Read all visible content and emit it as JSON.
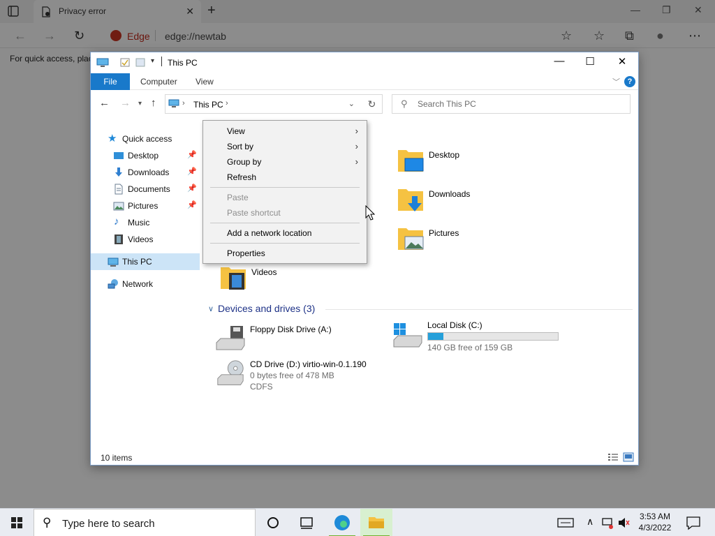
{
  "browser": {
    "tab_title": "Privacy error",
    "tab_close": "✕",
    "new_tab": "+",
    "brand": "Edge",
    "url": "edge://newtab",
    "quick_access_text": "For quick access, plac",
    "minimize": "—",
    "restore": "❐",
    "close": "✕"
  },
  "explorer": {
    "title": "This PC",
    "ribbon": {
      "file": "File",
      "computer": "Computer",
      "view": "View",
      "help": "?"
    },
    "address": {
      "crumb": "This PC",
      "separator": "›"
    },
    "search": {
      "placeholder": "Search This PC"
    },
    "nav": {
      "quick_access": "Quick access",
      "items": [
        {
          "label": "Desktop",
          "pinned": true
        },
        {
          "label": "Downloads",
          "pinned": true
        },
        {
          "label": "Documents",
          "pinned": true
        },
        {
          "label": "Pictures",
          "pinned": true
        },
        {
          "label": "Music",
          "pinned": false
        },
        {
          "label": "Videos",
          "pinned": false
        }
      ],
      "this_pc": "This PC",
      "network": "Network"
    },
    "folders": [
      {
        "label": "Desktop"
      },
      {
        "label": "Downloads"
      },
      {
        "label": "Pictures"
      },
      {
        "label": "Videos"
      }
    ],
    "devices_header": "Devices and drives (3)",
    "drives": {
      "floppy": {
        "name": "Floppy Disk Drive (A:)"
      },
      "local": {
        "name": "Local Disk (C:)",
        "free": "140 GB free of 159 GB",
        "used_fraction": 0.12
      },
      "cd": {
        "name": "CD Drive (D:) virtio-win-0.1.190",
        "free": "0 bytes free of 478 MB",
        "fs": "CDFS"
      }
    },
    "status": {
      "count": "10 items"
    }
  },
  "context_menu": {
    "items": [
      {
        "label": "View",
        "has_submenu": true,
        "disabled": false
      },
      {
        "label": "Sort by",
        "has_submenu": true,
        "disabled": false
      },
      {
        "label": "Group by",
        "has_submenu": true,
        "disabled": false
      },
      {
        "label": "Refresh",
        "has_submenu": false,
        "disabled": false
      },
      {
        "label": "Paste",
        "has_submenu": false,
        "disabled": true
      },
      {
        "label": "Paste shortcut",
        "has_submenu": false,
        "disabled": true
      },
      {
        "label": "Add a network location",
        "has_submenu": false,
        "disabled": false
      },
      {
        "label": "Properties",
        "has_submenu": false,
        "disabled": false
      }
    ]
  },
  "taskbar": {
    "search_placeholder": "Type here to search",
    "time": "3:53 AM",
    "date": "4/3/2022"
  },
  "colors": {
    "accent": "#1979ca",
    "selection": "#cce4f7",
    "drive_bar": "#26a0da",
    "folder_yellow": "#f5c242"
  }
}
